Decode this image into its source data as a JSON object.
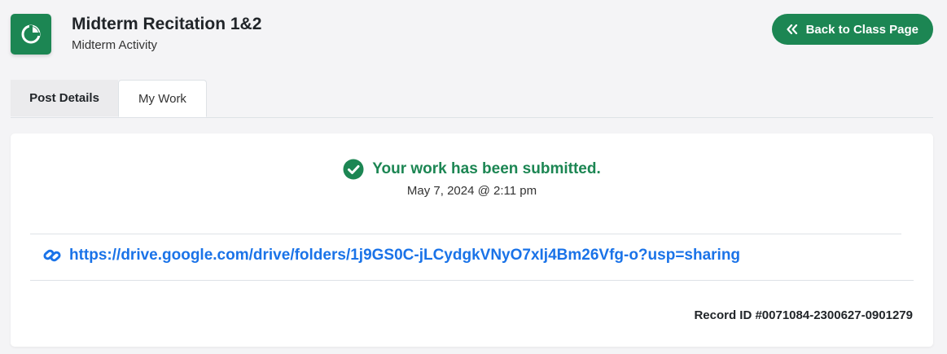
{
  "header": {
    "title": "Midterm Recitation 1&2",
    "subtitle": "Midterm Activity",
    "icon": "pie-chart-icon",
    "back_button": {
      "label": "Back to Class Page",
      "icon": "double-chevron-left-icon"
    }
  },
  "tabs": [
    {
      "label": "Post Details",
      "active": false
    },
    {
      "label": "My Work",
      "active": true
    }
  ],
  "submission": {
    "status_text": "Your work has been submitted.",
    "status_icon": "check-circle-icon",
    "timestamp": "May 7, 2024 @ 2:11 pm",
    "link": {
      "icon": "link-icon",
      "url": "https://drive.google.com/drive/folders/1j9GS0C-jLCydgkVNyO7xIj4Bm26Vfg-o?usp=sharing"
    },
    "record_id": "Record ID #0071084-2300627-0901279"
  },
  "colors": {
    "accent": "#1c8653",
    "link": "#1a73e8",
    "background": "#f4f4f6"
  }
}
